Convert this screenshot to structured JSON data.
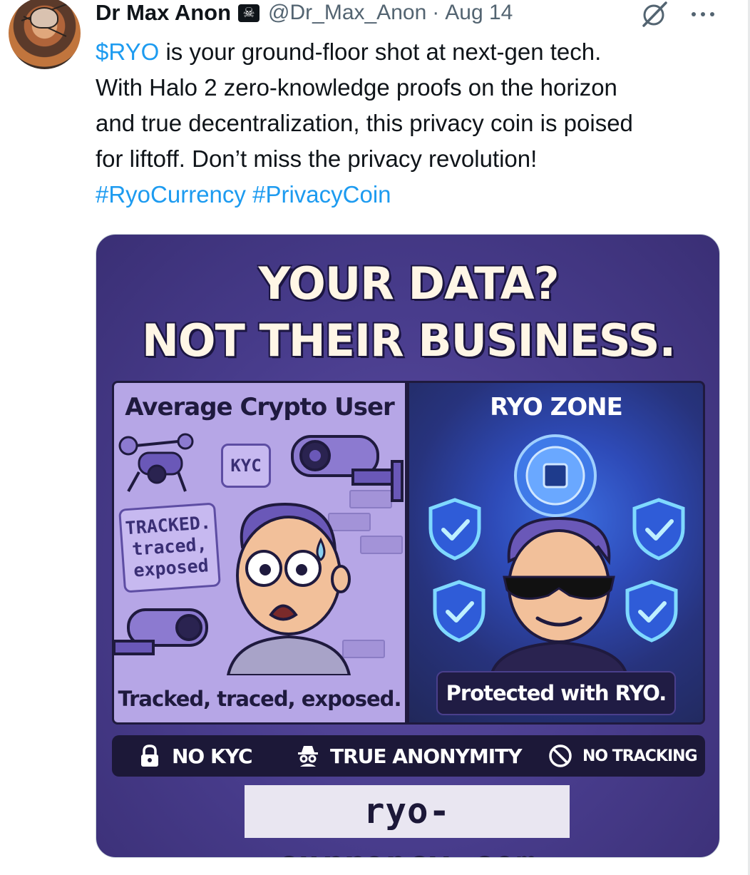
{
  "author": {
    "display_name": "Dr Max Anon",
    "badge_icon": "skull-crossbones-icon",
    "badge_glyph": "☠",
    "handle": "@Dr_Max_Anon",
    "separator": "·",
    "date": "Aug 14"
  },
  "actions": {
    "grok_icon": "grok-slash-circle-icon",
    "more_icon": "more-dots-icon"
  },
  "tweet": {
    "cashtag": "$RYO",
    "line1_rest": " is your ground-floor shot at next-gen tech.",
    "line2": "With Halo 2 zero-knowledge proofs on the horizon",
    "line3": "and true decentralization, this privacy coin is poised",
    "line4": "for liftoff. Don’t miss the privacy revolution!",
    "hashtag1": "#RyoCurrency",
    "hashtag2": "#PrivacyCoin"
  },
  "media": {
    "title_line1": "YOUR DATA?",
    "title_line2": "NOT THEIR BUSINESS.",
    "left_panel": {
      "heading": "Average Crypto User",
      "kyc_tag": "KYC",
      "tracked_tag_line1": "TRACKED.",
      "tracked_tag_line2": "traced,",
      "tracked_tag_line3": "exposed",
      "caption": "Tracked, traced, exposed."
    },
    "right_panel": {
      "heading": "RYO ZONE",
      "caption": "Protected with RYO."
    },
    "features": [
      {
        "label": "NO KYC",
        "icon": "padlock-icon"
      },
      {
        "label": "TRUE ANONYMITY",
        "icon": "incognito-spy-icon"
      },
      {
        "label": "NO TRACKING",
        "icon": "prohibited-icon"
      }
    ],
    "url": "ryo-currency.com"
  },
  "colors": {
    "link": "#1d9bf0",
    "muted": "#536471",
    "text": "#0f1419",
    "poster_bg": "#483c8c",
    "shield_glow": "#7fd9ff"
  }
}
